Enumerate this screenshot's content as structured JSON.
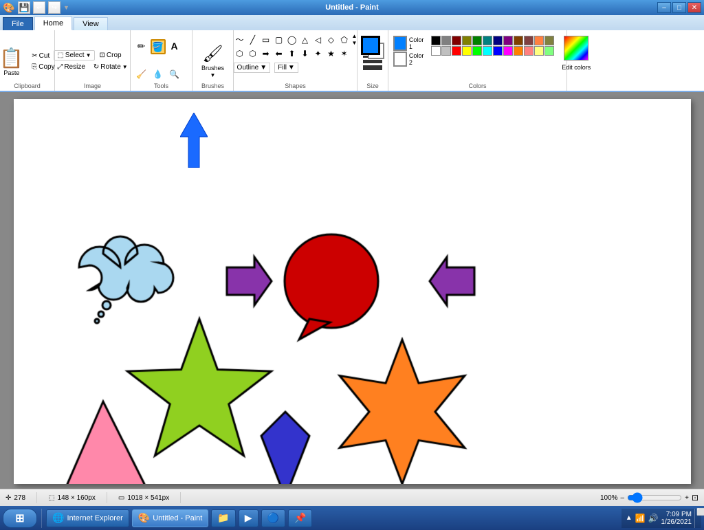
{
  "titlebar": {
    "title": "Untitled - Paint",
    "min_label": "–",
    "max_label": "□",
    "close_label": "✕"
  },
  "quickaccess": {
    "save_label": "💾",
    "undo_label": "↩",
    "redo_label": "↪"
  },
  "tabs": [
    {
      "id": "file",
      "label": "File"
    },
    {
      "id": "home",
      "label": "Home",
      "active": true
    },
    {
      "id": "view",
      "label": "View"
    }
  ],
  "ribbon": {
    "clipboard": {
      "label": "Clipboard",
      "paste": "Paste",
      "cut": "Cut",
      "copy": "Copy"
    },
    "image": {
      "label": "Image",
      "crop": "Crop",
      "resize": "Resize",
      "rotate": "Rotate",
      "select": "Select"
    },
    "tools": {
      "label": "Tools"
    },
    "brushes": {
      "label": "Brushes",
      "brushes": "Brushes"
    },
    "shapes": {
      "label": "Shapes",
      "outline": "Outline",
      "fill": "Fill"
    },
    "size": {
      "label": "Size",
      "size": "Size"
    },
    "colors": {
      "label": "Colors",
      "color1": "Color 1",
      "color2": "Color 2",
      "edit_colors": "Edit colors"
    }
  },
  "statusbar": {
    "cursor_pos": "278",
    "selection_size": "148 × 160px",
    "canvas_size": "1018 × 541px",
    "zoom": "100%"
  },
  "taskbar": {
    "start_label": "Start",
    "time": "7:09 PM",
    "date": "1/26/2021",
    "items": [
      {
        "id": "ie",
        "label": "Internet Explorer",
        "active": false
      },
      {
        "id": "paint",
        "label": "Untitled - Paint",
        "active": true
      }
    ]
  },
  "colors": {
    "palette": [
      "#000000",
      "#808080",
      "#800000",
      "#808000",
      "#008000",
      "#008080",
      "#000080",
      "#800080",
      "#804000",
      "#804040",
      "#ffffff",
      "#c0c0c0",
      "#ff0000",
      "#ffff00",
      "#00ff00",
      "#00ffff",
      "#0000ff",
      "#ff00ff",
      "#ff8040",
      "#ff8080",
      "#ff8040",
      "#ffff80",
      "#80ff80",
      "#80ffff",
      "#8080ff",
      "#ff80ff",
      "#ffc080",
      "#ffc0c0",
      "#ffff00",
      "#80ff00",
      "#00ff80",
      "#00ffff",
      "#0080ff",
      "#8000ff",
      "#ff0080",
      "#ff8000"
    ],
    "color1": "#0080ff",
    "color2": "#ffffff"
  }
}
